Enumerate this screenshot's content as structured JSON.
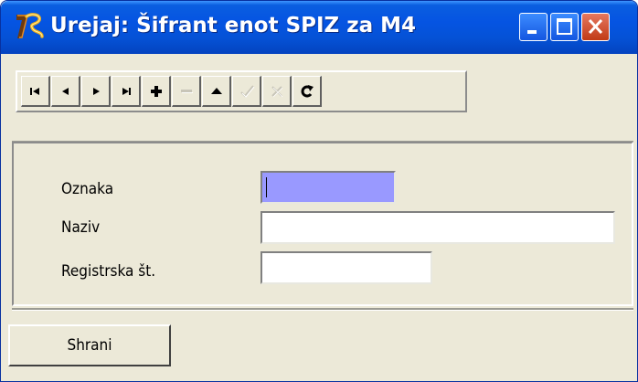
{
  "window": {
    "title": "Urejaj: Šifrant enot SPIZ za M4",
    "controls": [
      "minimize-icon",
      "maximize-icon",
      "close-icon"
    ]
  },
  "toolbar": {
    "buttons": [
      {
        "icon": "first-record-icon",
        "enabled": true
      },
      {
        "icon": "prior-record-icon",
        "enabled": true
      },
      {
        "icon": "next-record-icon",
        "enabled": true
      },
      {
        "icon": "last-record-icon",
        "enabled": true
      },
      {
        "icon": "insert-record-icon",
        "enabled": true
      },
      {
        "icon": "delete-record-icon",
        "enabled": false
      },
      {
        "icon": "edit-record-icon",
        "enabled": true
      },
      {
        "icon": "post-record-icon",
        "enabled": false
      },
      {
        "icon": "cancel-record-icon",
        "enabled": false
      },
      {
        "icon": "refresh-icon",
        "enabled": true
      }
    ]
  },
  "form": {
    "fields": [
      {
        "label": "Oznaka",
        "value": "",
        "focused": true
      },
      {
        "label": "Naziv",
        "value": ""
      },
      {
        "label": "Registrska št.",
        "value": ""
      }
    ],
    "focus_color": "#9999ff"
  },
  "actions": {
    "save_label": "Shrani"
  }
}
